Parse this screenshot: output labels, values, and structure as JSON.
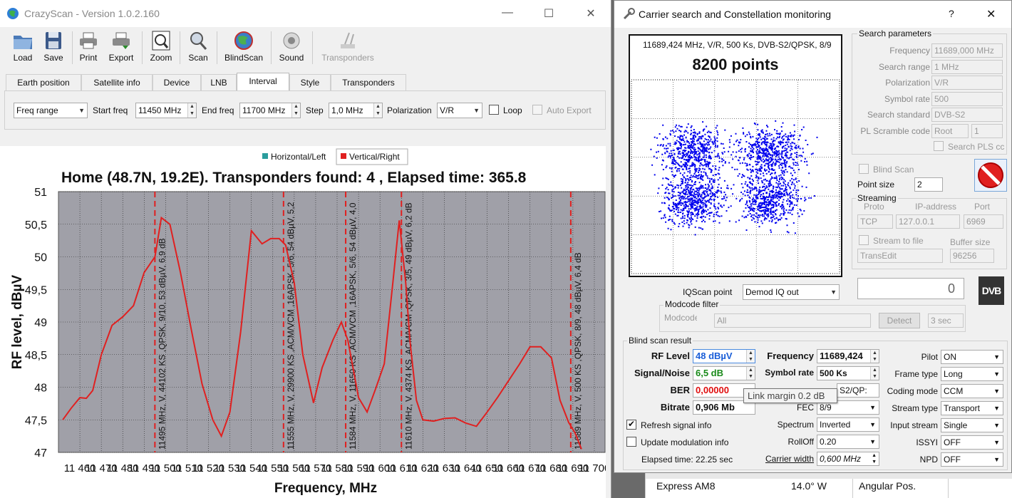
{
  "main_window": {
    "title": "CrazyScan - Version 1.0.2.160",
    "controls": {
      "minimize": "—",
      "maximize": "☐",
      "close": "✕"
    },
    "toolbar": [
      {
        "label": "Load",
        "icon": "folder-icon",
        "enabled": true
      },
      {
        "label": "Save",
        "icon": "floppy-icon",
        "enabled": true
      },
      {
        "label": "Print",
        "icon": "printer-icon",
        "enabled": true
      },
      {
        "label": "Export",
        "icon": "export-icon",
        "enabled": true
      },
      {
        "label": "Zoom",
        "icon": "zoom-icon",
        "enabled": true
      },
      {
        "label": "Scan",
        "icon": "scan-icon",
        "enabled": true
      },
      {
        "label": "BlindScan",
        "icon": "globe-icon",
        "enabled": true
      },
      {
        "label": "Sound",
        "icon": "speaker-icon",
        "enabled": true
      },
      {
        "label": "Transponders",
        "icon": "transponders-icon",
        "enabled": false
      }
    ],
    "tabs": [
      "Earth position",
      "Satellite info",
      "Device",
      "LNB",
      "Interval",
      "Style",
      "Transponders"
    ],
    "active_tab": "Interval",
    "interval": {
      "mode": "Freq range",
      "start_label": "Start freq",
      "start_value": "11450 MHz",
      "end_label": "End freq",
      "end_value": "11700 MHz",
      "step_label": "Step",
      "step_value": "1,0 MHz",
      "polarization_label": "Polarization",
      "polarization_value": "V/R",
      "loop_label": "Loop",
      "auto_export_label": "Auto Export"
    }
  },
  "chart_data": {
    "type": "line",
    "title": "Home (48.7N, 19.2E). Transponders found: 4 , Elapsed time: 365.8",
    "xlabel": "Frequency, MHz",
    "ylabel": "RF level, dBµV",
    "xlim": [
      11450,
      11705
    ],
    "ylim": [
      47,
      51
    ],
    "x_ticks": [
      11460,
      11470,
      11480,
      11490,
      11500,
      11510,
      11520,
      11530,
      11540,
      11550,
      11560,
      11570,
      11580,
      11590,
      11600,
      11610,
      11620,
      11630,
      11640,
      11650,
      11660,
      11670,
      11680,
      11690,
      11700
    ],
    "x_tick_labels": [
      "11 460",
      "11 470",
      "11 480",
      "11 490",
      "11 500",
      "11 510",
      "11 520",
      "11 530",
      "11 540",
      "11 550",
      "11 560",
      "11 570",
      "11 580",
      "11 590",
      "11 600",
      "11 610",
      "11 620",
      "11 630",
      "11 640",
      "11 650",
      "11 660",
      "11 670",
      "11 680",
      "11 690",
      "11 700"
    ],
    "y_ticks": [
      47,
      47.5,
      48,
      48.5,
      49,
      49.5,
      50,
      50.5,
      51
    ],
    "y_tick_labels": [
      "47",
      "47,5",
      "48",
      "48,5",
      "49",
      "49,5",
      "50",
      "50,5",
      "51"
    ],
    "grid": true,
    "legend_position": "top",
    "series": [
      {
        "name": "Horizontal/Left",
        "color": "#2a9d9d",
        "x": [],
        "y": []
      },
      {
        "name": "Vertical/Right",
        "color": "#e02020",
        "x": [
          11452,
          11456,
          11460,
          11463,
          11466,
          11470,
          11475,
          11480,
          11485,
          11490,
          11495,
          11498,
          11502,
          11507,
          11512,
          11517,
          11522,
          11526,
          11530,
          11535,
          11540,
          11545,
          11549,
          11553,
          11556,
          11560,
          11564,
          11569,
          11573,
          11578,
          11582,
          11585,
          11590,
          11594,
          11598,
          11602,
          11606,
          11609,
          11612,
          11614,
          11617,
          11620,
          11625,
          11630,
          11635,
          11640,
          11645,
          11650,
          11655,
          11660,
          11665,
          11670,
          11675,
          11680,
          11684,
          11688,
          11691,
          11694
        ],
        "y": [
          47.5,
          47.68,
          47.84,
          47.83,
          47.95,
          48.5,
          48.95,
          49.08,
          49.25,
          49.76,
          50.0,
          50.6,
          50.5,
          49.75,
          48.88,
          48.05,
          47.5,
          47.25,
          47.62,
          48.85,
          50.4,
          50.2,
          50.28,
          50.28,
          50.18,
          49.6,
          48.5,
          47.76,
          48.3,
          48.72,
          49.0,
          48.72,
          47.84,
          47.62,
          47.98,
          48.36,
          49.6,
          50.56,
          49.6,
          48.7,
          47.8,
          47.5,
          47.48,
          47.52,
          47.53,
          47.45,
          47.4,
          47.62,
          47.85,
          48.1,
          48.35,
          48.62,
          48.62,
          48.45,
          47.8,
          47.46,
          47.3,
          47.05
        ]
      }
    ],
    "markers": [
      {
        "x": 11495,
        "label": "11495 MHz, V, 44102 KS ,QPSK, 9/10, 53 dBµV, 6,9 dB"
      },
      {
        "x": 11555,
        "label": "11555 MHz, V, 29900 KS ,ACM/VCM ,16APSK, 5/6, 54 dBµV, 5,2"
      },
      {
        "x": 11584,
        "label": "11584 MHz, V, 11650 KS ,ACM/VCM ,16APSK, 5/6, 54 dBµV, 4,0"
      },
      {
        "x": 11610,
        "label": "11610 MHz, V, 4374 KS ,ACM/VCM ,QPSK, 3/5, 49 dBµV, 6,2 dB"
      },
      {
        "x": 11689,
        "label": "11689 MHz, V, 500 KS ,QPSK, 8/9, 48 dBµV, 6,4 dB"
      }
    ]
  },
  "dialog": {
    "title": "Carrier search and Constellation monitoring",
    "help": "?",
    "close": "✕",
    "constellation": {
      "header": "11689,424 MHz, V/R, 500 Ks, DVB-S2/QPSK, 8/9",
      "points_label": "8200 points",
      "point_color": "#0000ee"
    },
    "search_params": {
      "title": "Search parameters",
      "rows": [
        {
          "label": "Frequency",
          "value": "11689,000 MHz",
          "kind": "spin"
        },
        {
          "label": "Search range",
          "value": "1 MHz",
          "kind": "spin"
        },
        {
          "label": "Polarization",
          "value": "V/R",
          "kind": "combo"
        },
        {
          "label": "Symbol rate",
          "value": "500",
          "kind": "combo"
        },
        {
          "label": "Search standard",
          "value": "DVB-S2",
          "kind": "combo"
        }
      ],
      "pl_scramble_label": "PL Scramble code",
      "pl_scramble_mode": "Root",
      "pl_scramble_value": "1",
      "search_pls_label": "Search PLS cc"
    },
    "blind_scan_label": "Blind Scan",
    "point_size_label": "Point size",
    "point_size_value": "2",
    "streaming": {
      "title": "Streaming",
      "proto_label": "Proto",
      "proto_value": "TCP",
      "ip_label": "IP-address",
      "ip_value": "127.0.0.1",
      "port_label": "Port",
      "port_value": "6969",
      "stream_to_file_label": "Stream to file",
      "buffer_label": "Buffer size",
      "file_format": "TransEdit",
      "buffer_value": "96256"
    },
    "small_display": "0",
    "dvb_logo": "DVB",
    "iqscan_label": "IQScan point",
    "iqscan_value": "Demod IQ out",
    "modcode": {
      "title": "Modcode filter",
      "label": "Modcode",
      "value": "All",
      "detect_label": "Detect",
      "seconds_value": "3 sec"
    },
    "result": {
      "title": "Blind scan result",
      "rf_label": "RF Level",
      "rf_value": "48 dBµV",
      "rf_color": "#1a5ed8",
      "sn_label": "Signal/Noise",
      "sn_value": "6,5 dB",
      "sn_color": "#1a8a1a",
      "ber_label": "BER",
      "ber_value": "0,00000",
      "ber_color": "#e01010",
      "bitrate_label": "Bitrate",
      "bitrate_value": "0,906 Mb",
      "tooltip": "Link margin 0.2 dB",
      "frequency_label": "Frequency",
      "frequency_value": "11689,424",
      "symbolrate_label": "Symbol rate",
      "symbolrate_value": "500 Ks",
      "modulation_value": "S2/QP:",
      "fec_label": "FEC",
      "fec_value": "8/9",
      "spectrum_label": "Spectrum",
      "spectrum_value": "Inverted",
      "rolloff_label": "RollOff",
      "rolloff_value": "0.20",
      "carrier_width_label": "Carrier width",
      "carrier_width_value": "0,600 MHz",
      "refresh_label": "Refresh signal info",
      "update_mod_label": "Update modulation info",
      "elapsed_label": "Elapsed time: 22.25 sec",
      "pilot_label": "Pilot",
      "pilot_value": "ON",
      "frametype_label": "Frame type",
      "frametype_value": "Long",
      "codingmode_label": "Coding mode",
      "codingmode_value": "CCM",
      "streamtype_label": "Stream type",
      "streamtype_value": "Transport",
      "inputstream_label": "Input stream",
      "inputstream_value": "Single",
      "issyi_label": "ISSYI",
      "issyi_value": "OFF",
      "npd_label": "NPD",
      "npd_value": "OFF"
    }
  },
  "background_table": {
    "satellite": "Express AM8",
    "position": "14.0° W",
    "column": "Angular Pos."
  }
}
